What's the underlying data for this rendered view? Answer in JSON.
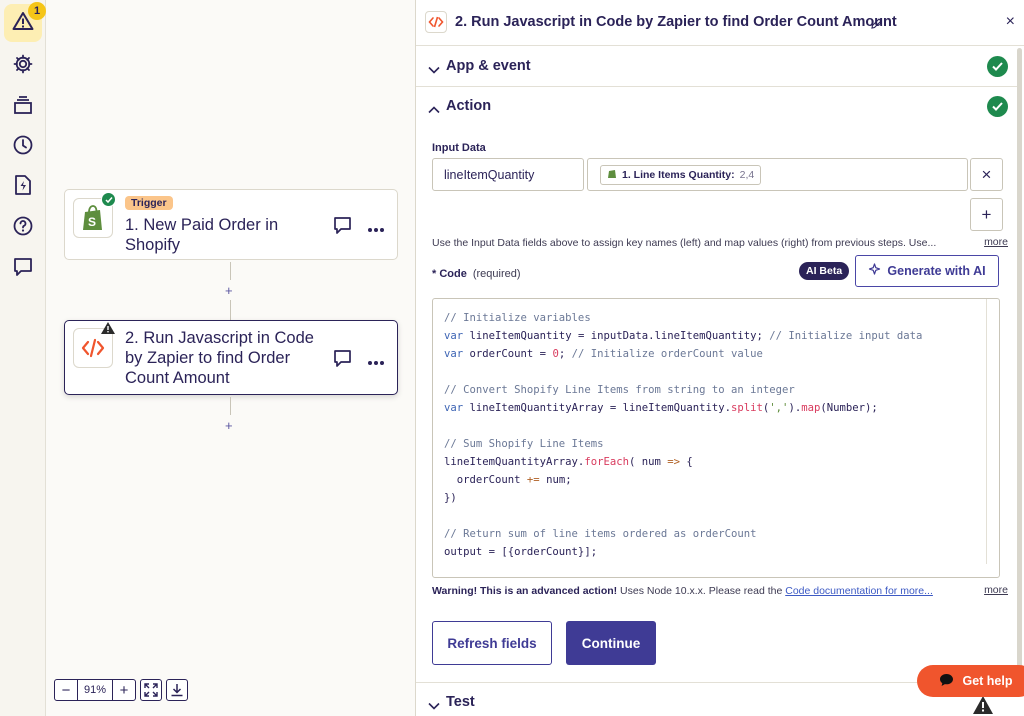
{
  "sidebar": {
    "alert_badge": "1",
    "items": [
      "warning-icon",
      "gear-icon",
      "layers-icon",
      "clock-icon",
      "zap-file-icon",
      "help-icon",
      "comment-icon"
    ]
  },
  "canvas": {
    "nodes": [
      {
        "pill": "Trigger",
        "title": "1. New Paid Order in Shopify",
        "status": "success"
      },
      {
        "title": "2. Run Javascript in Code by Zapier to find Order Count Amount",
        "status": "warning"
      }
    ],
    "plus": "+",
    "zoom": {
      "minus": "−",
      "level": "91%",
      "plus": "+"
    }
  },
  "panel": {
    "title": "2. Run Javascript in Code by Zapier to find Order Count Amount",
    "close": "×",
    "sections": {
      "app_event": "App & event",
      "action": "Action",
      "test": "Test"
    },
    "input_data": {
      "label": "Input Data",
      "key": "lineItemQuantity",
      "chip_label": "1. Line Items Quantity:",
      "chip_value": "2,4",
      "remove": "×",
      "add": "+"
    },
    "help_text": "Use the Input Data fields above to assign key names (left) and map values (right) from previous steps. Use...",
    "more": "more",
    "code": {
      "label": "* Code",
      "required": "(required)",
      "ai_beta": "AI Beta",
      "generate": "Generate with AI"
    },
    "warning": {
      "bold": "Warning! This is an advanced action!",
      "text": " Uses Node 10.x.x. Please read the ",
      "link": "Code documentation for more...",
      "more": "more"
    },
    "buttons": {
      "refresh": "Refresh fields",
      "continue": "Continue"
    }
  },
  "get_help": "Get help",
  "colors": {
    "accent": "#3f3b95",
    "success": "#1e8a4e",
    "help": "#f0552d",
    "code_orange": "#f0552d"
  }
}
